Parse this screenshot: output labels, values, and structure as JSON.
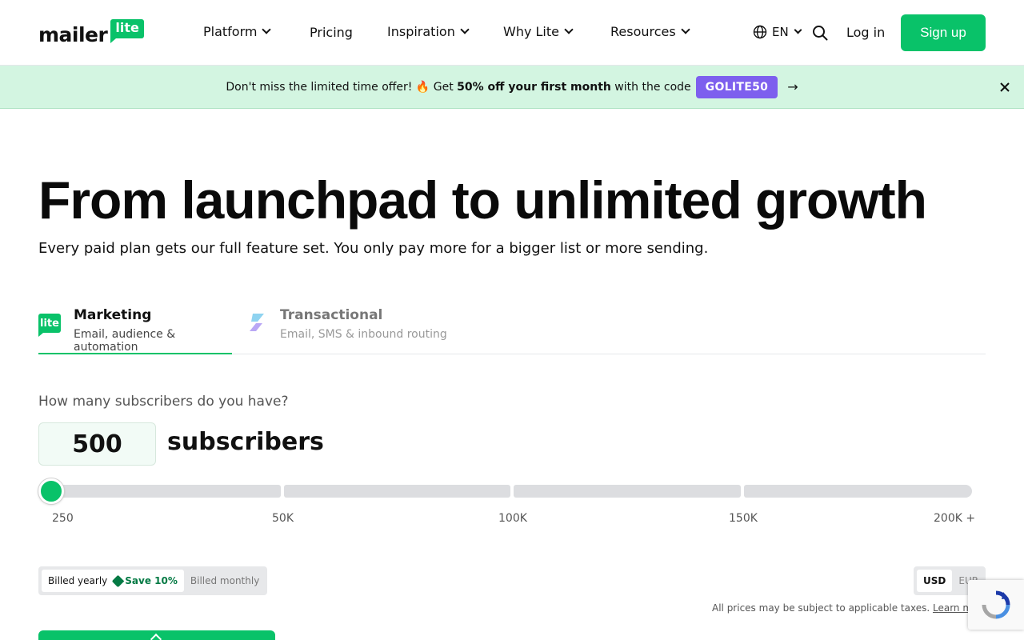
{
  "logo": {
    "word": "mailer",
    "badge": "lite"
  },
  "nav": {
    "items": [
      {
        "label": "Platform",
        "dropdown": true
      },
      {
        "label": "Pricing",
        "dropdown": false
      },
      {
        "label": "Inspiration",
        "dropdown": true
      },
      {
        "label": "Why Lite",
        "dropdown": true
      },
      {
        "label": "Resources",
        "dropdown": true
      }
    ],
    "language": "EN",
    "login": "Log in",
    "signup": "Sign up"
  },
  "banner": {
    "text_before": "Don't miss the limited time offer! 🔥 Get ",
    "bold": "50% off your first month",
    "text_after": " with the code",
    "code": "GOLITE50",
    "arrow": "→"
  },
  "hero": {
    "title": "From launchpad to unlimited growth",
    "subtitle": "Every paid plan gets our full feature set. You only pay more for a bigger list or more sending."
  },
  "tabs": [
    {
      "icon_text": "lite",
      "title": "Marketing",
      "desc": "Email, audience & automation",
      "active": true
    },
    {
      "title": "Transactional",
      "desc": "Email, SMS & inbound routing",
      "active": false
    }
  ],
  "subscribers": {
    "question": "How many subscribers do you have?",
    "count": "500",
    "unit": "subscribers",
    "slider_fraction": 0.0,
    "ticks": [
      "250",
      "50K",
      "100K",
      "150K",
      "200K +"
    ]
  },
  "billing": {
    "yearly": "Billed yearly",
    "save": "Save 10%",
    "monthly": "Billed monthly",
    "selected": "yearly"
  },
  "currency": {
    "options": [
      "USD",
      "EUR"
    ],
    "selected": "USD"
  },
  "taxes": {
    "text": "All prices may be subject to applicable taxes. ",
    "link": "Learn mo"
  },
  "colors": {
    "brand_green": "#09c269",
    "banner_bg": "#d3f5e1",
    "code_purple": "#7d5fee",
    "save_green": "#047a44"
  }
}
